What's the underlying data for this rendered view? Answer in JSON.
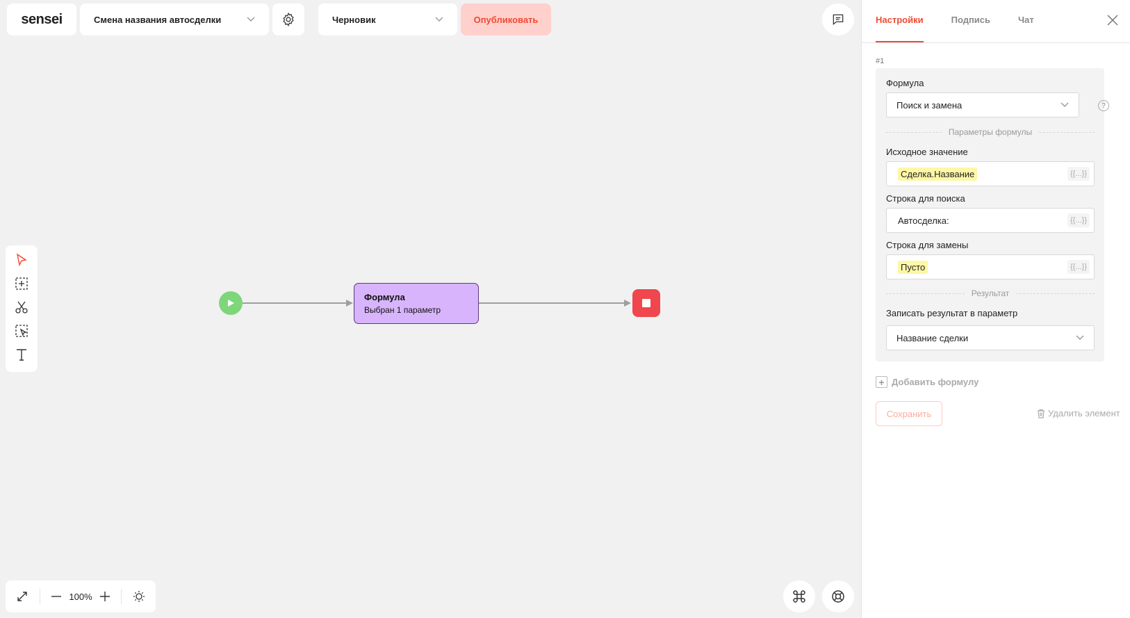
{
  "header": {
    "logo": "sensei",
    "process_title": "Смена названия автосделки",
    "status": "Черновик",
    "publish_label": "Опубликовать"
  },
  "canvas": {
    "node": {
      "title": "Формула",
      "subtitle": "Выбран 1 параметр"
    },
    "zoom": "100%"
  },
  "tools": [
    "pointer-icon",
    "add-area-icon",
    "scissors-icon",
    "select-area-icon",
    "text-icon"
  ],
  "panel": {
    "tabs": [
      "Настройки",
      "Подпись",
      "Чат"
    ],
    "active_tab": "Настройки",
    "index": "#1",
    "formula_label": "Формула",
    "formula_value": "Поиск и замена",
    "params_divider": "Параметры формулы",
    "source_label": "Исходное значение",
    "source_value": "Сделка.Название",
    "search_label": "Строка для поиска",
    "search_value": "Автосделка:",
    "replace_label": "Строка для замены",
    "replace_value": "Пусто",
    "result_divider": "Результат",
    "write_label": "Записать результат в параметр",
    "write_value": "Название сделки",
    "braces": "{{...}}",
    "add_formula": "Добавить формулу",
    "save": "Сохранить",
    "delete": "Удалить элемент"
  },
  "colors": {
    "accent": "#f04a32",
    "start": "#7ed67a",
    "stop": "#f0464d",
    "node": "#d7b4fb",
    "chip": "#fdf7a6"
  }
}
